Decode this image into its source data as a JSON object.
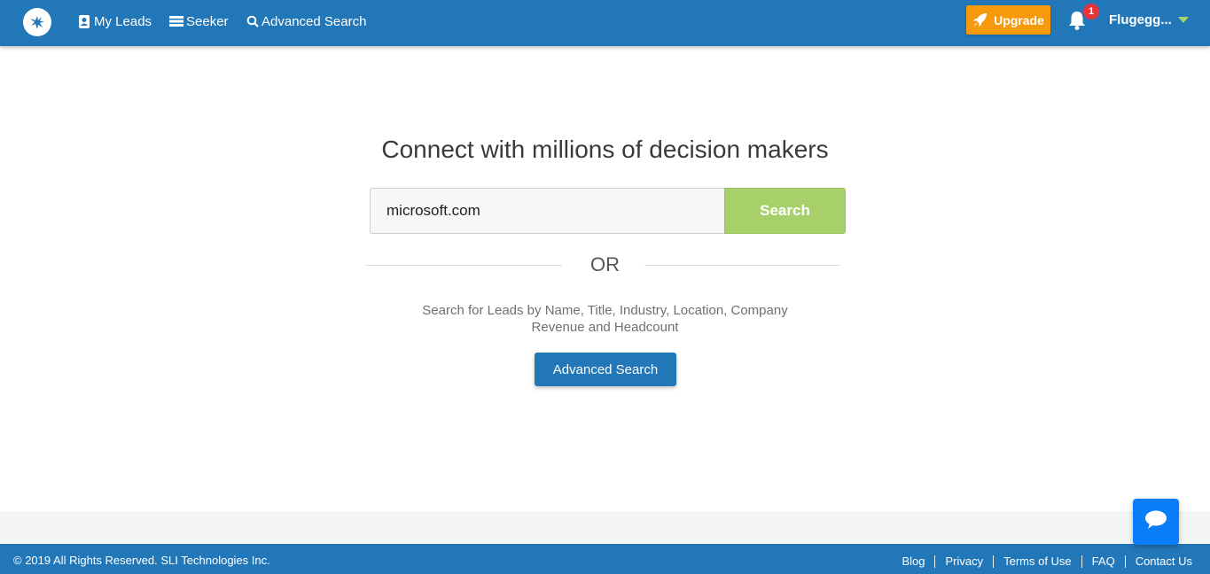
{
  "navbar": {
    "logo_icon": "gecko-logo-icon",
    "items": [
      {
        "label": "My Leads",
        "icon": "address-book-icon"
      },
      {
        "label": "Seeker",
        "icon": "list-icon"
      },
      {
        "label": "Advanced Search",
        "icon": "search-icon"
      }
    ],
    "upgrade_label": "Upgrade",
    "upgrade_icon": "rocket-icon",
    "notification_count": "1",
    "user_name": "Flugegg...",
    "colors": {
      "bar": "#2277b8",
      "upgrade": "#f7990c",
      "badge": "#e8333d",
      "caret": "#a9d36b"
    }
  },
  "main": {
    "title": "Connect with millions of decision makers",
    "search": {
      "value": "microsoft.com",
      "button_label": "Search"
    },
    "or_label": "OR",
    "description_line1": "Search for Leads by Name, Title, Industry, Location, Company",
    "description_line2": "Revenue and Headcount",
    "advanced_button_label": "Advanced Search",
    "colors": {
      "search_button": "#a8d06a",
      "advanced_button": "#2277b8"
    }
  },
  "footer": {
    "copyright": "© 2019 All Rights Reserved. SLI Technologies Inc.",
    "links": [
      "Blog",
      "Privacy",
      "Terms of Use",
      "FAQ",
      "Contact Us"
    ]
  },
  "chat_widget": {
    "icon": "chat-bubble-icon",
    "color": "#0a7ef8"
  }
}
